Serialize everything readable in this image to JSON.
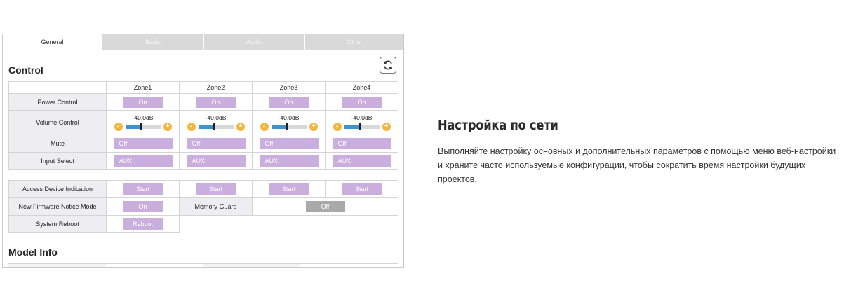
{
  "tabs": [
    {
      "label": "General",
      "active": true
    },
    {
      "label": "Basic",
      "active": false
    },
    {
      "label": "Audio",
      "active": false
    },
    {
      "label": "Other",
      "active": false
    }
  ],
  "control": {
    "title": "Control",
    "zones": [
      "Zone1",
      "Zone2",
      "Zone3",
      "Zone4"
    ],
    "rows": {
      "power": {
        "label": "Power Control",
        "values": [
          "On",
          "On",
          "On",
          "On"
        ]
      },
      "volume": {
        "label": "Volume Control",
        "values": [
          "-40.0dB",
          "-40.0dB",
          "-40.0dB",
          "-40.0dB"
        ],
        "level_fraction": 0.45,
        "minus": "-",
        "plus": "+"
      },
      "mute": {
        "label": "Mute",
        "values": [
          "Off",
          "Off",
          "Off",
          "Off"
        ]
      },
      "input": {
        "label": "Input Select",
        "values": [
          "AUX",
          "AUX",
          "AUX",
          "AUX"
        ]
      }
    },
    "access_device": {
      "label": "Access Device Indication",
      "button": "Start"
    },
    "firmware_notice": {
      "label": "New Firmware Notice Mode",
      "value": "On"
    },
    "memory_guard": {
      "label": "Memory Guard",
      "value": "Off"
    },
    "system_reboot": {
      "label": "System Reboot",
      "button": "Reboot"
    }
  },
  "model_info": {
    "title": "Model Info"
  },
  "feature": {
    "title": "Настройка по сети",
    "description": "Выполняйте настройку основных и дополнительных параметров с помощью меню веб-настройки и храните часто используемые конфигурации, чтобы сократить время настройки будущих проектов."
  },
  "colors": {
    "button_purple": "#c9aede",
    "button_gray": "#a9a9a9",
    "slider_fill": "#3a93d3",
    "volume_buttons": "#f3b640"
  },
  "icons": {
    "refresh": "refresh-icon"
  }
}
